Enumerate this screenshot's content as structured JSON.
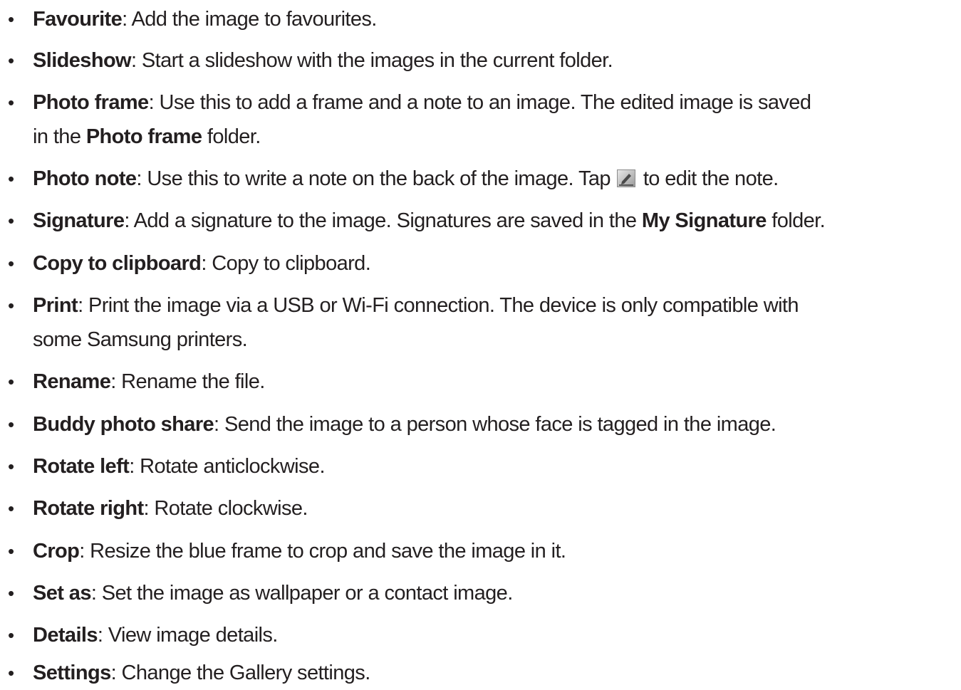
{
  "options": [
    {
      "term": "Favourite",
      "desc": ": Add the image to favourites."
    },
    {
      "term": "Slideshow",
      "desc": ": Start a slideshow with the images in the current folder."
    },
    {
      "term": "Photo frame",
      "desc": ": Use this to add a frame and a note to an image. The edited image is saved",
      "line2_pre": "in the ",
      "line2_emph": "Photo frame",
      "line2_post": " folder."
    },
    {
      "term": "Photo note",
      "desc": ": Use this to write a note on the back of the image. Tap ",
      "icon": "edit-pencil-icon",
      "desc_after_icon": " to edit the note."
    },
    {
      "term": "Signature",
      "desc": ": Add a signature to the image. Signatures are saved in the ",
      "emph": "My Signature",
      "desc_after_emph": " folder."
    },
    {
      "term": "Copy to clipboard",
      "desc": ": Copy to clipboard."
    },
    {
      "term": "Print",
      "desc": ": Print the image via a USB or Wi-Fi connection. The device is only compatible with",
      "line2": "some Samsung printers."
    },
    {
      "term": "Rename",
      "desc": ": Rename the file."
    },
    {
      "term": "Buddy photo share",
      "desc": ": Send the image to a person whose face is tagged in the image."
    },
    {
      "term": "Rotate left",
      "desc": ": Rotate anticlockwise."
    },
    {
      "term": "Rotate right",
      "desc": ": Rotate clockwise."
    },
    {
      "term": "Crop",
      "desc": ": Resize the blue frame to crop and save the image in it."
    },
    {
      "term": "Set as",
      "desc": ": Set the image as wallpaper or a contact image."
    },
    {
      "term": "Details",
      "desc": ": View image details."
    },
    {
      "term": "Settings",
      "desc": ": Change the Gallery settings."
    }
  ],
  "bullet_char": "•"
}
